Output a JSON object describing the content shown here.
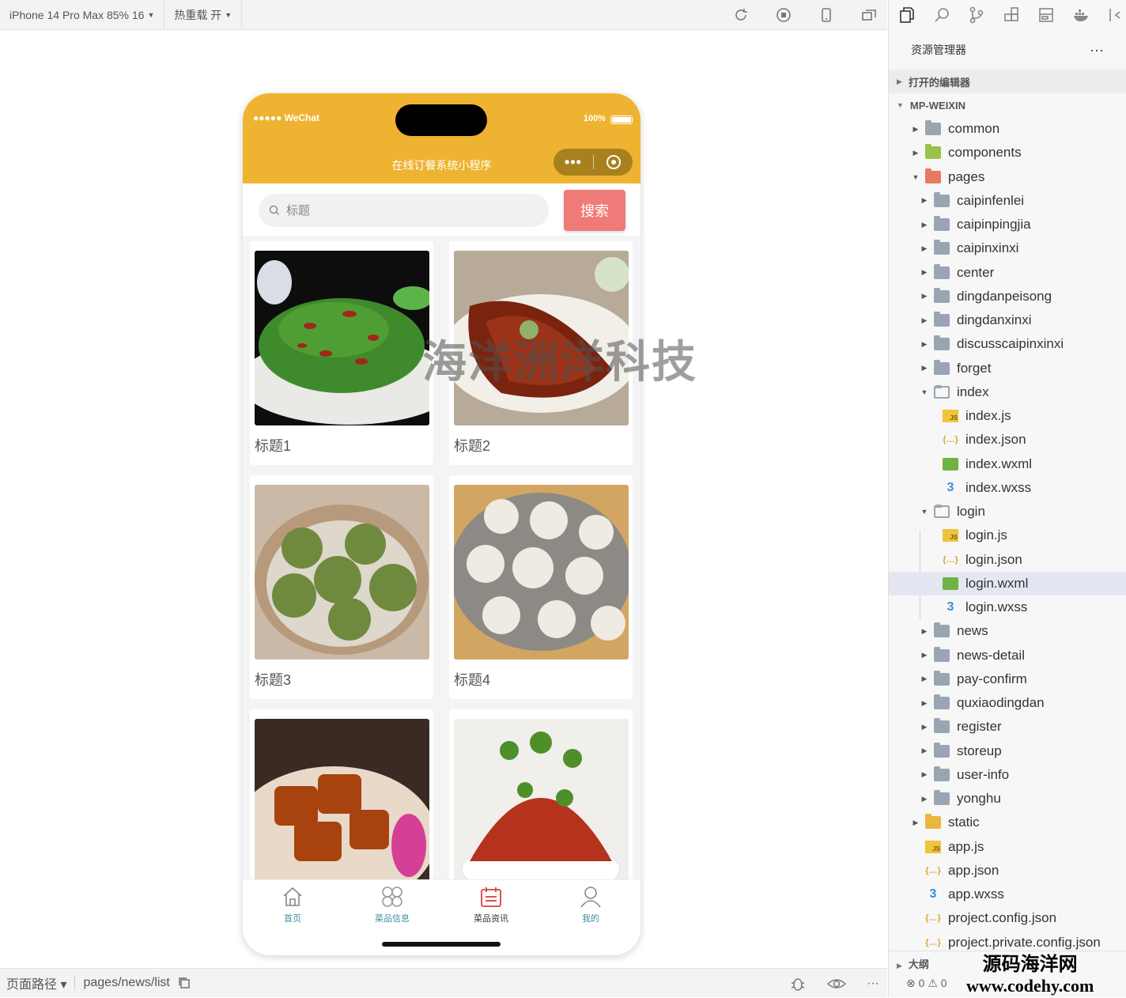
{
  "toolbar": {
    "device": "iPhone 14 Pro Max 85% 16",
    "hot_reload": "热重载 开"
  },
  "phone": {
    "carrier": "●●●●● WeChat",
    "battery": "100%",
    "nav_title": "在线订餐系统小程序",
    "capsule_more": "•••",
    "search": {
      "placeholder": "标题",
      "button": "搜索"
    },
    "cards": [
      {
        "caption": "标题1",
        "image": "green-bean-chili-dish"
      },
      {
        "caption": "标题2",
        "image": "braised-fish-dish"
      },
      {
        "caption": "标题3",
        "image": "green-rice-dumplings"
      },
      {
        "caption": "标题4",
        "image": "soup-dumplings-steamer"
      },
      {
        "caption": "",
        "image": "braised-pork-dish"
      },
      {
        "caption": "",
        "image": "spicy-meat-cilantro-dish"
      }
    ],
    "tabs": [
      {
        "label": "首页",
        "icon": "home-icon",
        "active": false
      },
      {
        "label": "菜品信息",
        "icon": "grid-icon",
        "active": false
      },
      {
        "label": "菜品资讯",
        "icon": "calendar-icon",
        "active": true
      },
      {
        "label": "我的",
        "icon": "user-icon",
        "active": false
      }
    ],
    "watermark": "海洋洲洋科技",
    "accent": "#efb332",
    "button_color": "#ee7b77"
  },
  "bottombar": {
    "path_label": "页面路径 ▾",
    "path": "pages/news/list"
  },
  "explorer": {
    "title": "资源管理器",
    "more": "···",
    "open_editors": "打开的编辑器",
    "project": "MP-WEIXIN",
    "tree": [
      {
        "name": "common",
        "type": "folder",
        "depth": 0,
        "open": false
      },
      {
        "name": "components",
        "type": "folder-comp",
        "depth": 0,
        "open": false
      },
      {
        "name": "pages",
        "type": "folder-pages",
        "depth": 0,
        "open": true
      },
      {
        "name": "caipinfenlei",
        "type": "folder",
        "depth": 1,
        "open": false
      },
      {
        "name": "caipinpingjia",
        "type": "folder",
        "depth": 1,
        "open": false
      },
      {
        "name": "caipinxinxi",
        "type": "folder",
        "depth": 1,
        "open": false
      },
      {
        "name": "center",
        "type": "folder",
        "depth": 1,
        "open": false
      },
      {
        "name": "dingdanpeisong",
        "type": "folder",
        "depth": 1,
        "open": false
      },
      {
        "name": "dingdanxinxi",
        "type": "folder",
        "depth": 1,
        "open": false
      },
      {
        "name": "discusscaipinxinxi",
        "type": "folder",
        "depth": 1,
        "open": false
      },
      {
        "name": "forget",
        "type": "folder",
        "depth": 1,
        "open": false
      },
      {
        "name": "index",
        "type": "folder",
        "depth": 1,
        "open": true
      },
      {
        "name": "index.js",
        "type": "js",
        "depth": 2
      },
      {
        "name": "index.json",
        "type": "json",
        "depth": 2
      },
      {
        "name": "index.wxml",
        "type": "wxml",
        "depth": 2
      },
      {
        "name": "index.wxss",
        "type": "wxss",
        "depth": 2
      },
      {
        "name": "login",
        "type": "folder",
        "depth": 1,
        "open": true
      },
      {
        "name": "login.js",
        "type": "js",
        "depth": 2
      },
      {
        "name": "login.json",
        "type": "json",
        "depth": 2
      },
      {
        "name": "login.wxml",
        "type": "wxml",
        "depth": 2,
        "selected": true
      },
      {
        "name": "login.wxss",
        "type": "wxss",
        "depth": 2
      },
      {
        "name": "news",
        "type": "folder",
        "depth": 1,
        "open": false
      },
      {
        "name": "news-detail",
        "type": "folder",
        "depth": 1,
        "open": false
      },
      {
        "name": "pay-confirm",
        "type": "folder",
        "depth": 1,
        "open": false
      },
      {
        "name": "quxiaodingdan",
        "type": "folder",
        "depth": 1,
        "open": false
      },
      {
        "name": "register",
        "type": "folder",
        "depth": 1,
        "open": false
      },
      {
        "name": "storeup",
        "type": "folder",
        "depth": 1,
        "open": false
      },
      {
        "name": "user-info",
        "type": "folder",
        "depth": 1,
        "open": false
      },
      {
        "name": "yonghu",
        "type": "folder",
        "depth": 1,
        "open": false
      },
      {
        "name": "static",
        "type": "folder-static",
        "depth": 0,
        "open": false
      },
      {
        "name": "app.js",
        "type": "js",
        "depth": 0
      },
      {
        "name": "app.json",
        "type": "json",
        "depth": 0
      },
      {
        "name": "app.wxss",
        "type": "wxss",
        "depth": 0
      },
      {
        "name": "project.config.json",
        "type": "json",
        "depth": 0
      },
      {
        "name": "project.private.config.json",
        "type": "json",
        "depth": 0
      }
    ],
    "outline": "大纲",
    "errors": "⊗ 0 ⚠ 0"
  },
  "brand": {
    "line1": "源码海洋网",
    "line2": "www.codehy.com"
  }
}
